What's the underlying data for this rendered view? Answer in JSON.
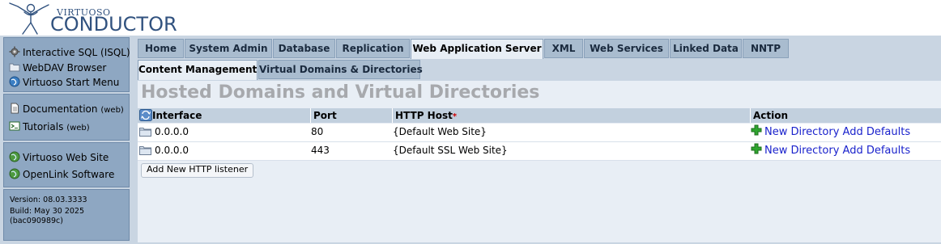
{
  "brand": {
    "top": "VIRTUOSO",
    "main": "CONDUCTOR"
  },
  "leftnav": {
    "group1": [
      {
        "label": "Interactive SQL (ISQL)",
        "icon": "gear-icon"
      },
      {
        "label": "WebDAV Browser",
        "icon": "folder-icon"
      },
      {
        "label": "Virtuoso Start Menu",
        "icon": "globe-icon"
      }
    ],
    "group2": [
      {
        "label": "Documentation",
        "suffix": "(web)",
        "icon": "document-icon"
      },
      {
        "label": "Tutorials",
        "suffix": "(web)",
        "icon": "terminal-icon"
      }
    ],
    "group3": [
      {
        "label": "Virtuoso Web Site",
        "icon": "globe-icon"
      },
      {
        "label": "OpenLink Software",
        "icon": "globe-icon"
      }
    ],
    "version": {
      "line1": "Version: 08.03.3333",
      "line2": "Build: May 30 2025",
      "line3": "(bac090989c)"
    }
  },
  "tabs": [
    "Home",
    "System Admin",
    "Database",
    "Replication",
    "Web Application Server",
    "XML",
    "Web Services",
    "Linked Data",
    "NNTP"
  ],
  "active_tab": "Web Application Server",
  "subtabs": [
    "Content Management",
    "Virtual Domains & Directories"
  ],
  "page_title": "Hosted Domains and Virtual Directories",
  "table": {
    "columns": {
      "interface": "Interface",
      "port": "Port",
      "host": "HTTP Host",
      "required_mark": "*",
      "action": "Action"
    },
    "rows": [
      {
        "interface": "0.0.0.0",
        "port": "80",
        "host": "{Default Web Site}",
        "action": "New Directory Add Defaults"
      },
      {
        "interface": "0.0.0.0",
        "port": "443",
        "host": "{Default SSL Web Site}",
        "action": "New Directory Add Defaults"
      }
    ]
  },
  "add_listener_label": "Add New HTTP listener",
  "colors": {
    "title_gray": "#a7a9ad",
    "link_blue": "#1a22cc",
    "nav_blue": "#8ea7c2",
    "panel_bg": "#c9d5e2"
  }
}
